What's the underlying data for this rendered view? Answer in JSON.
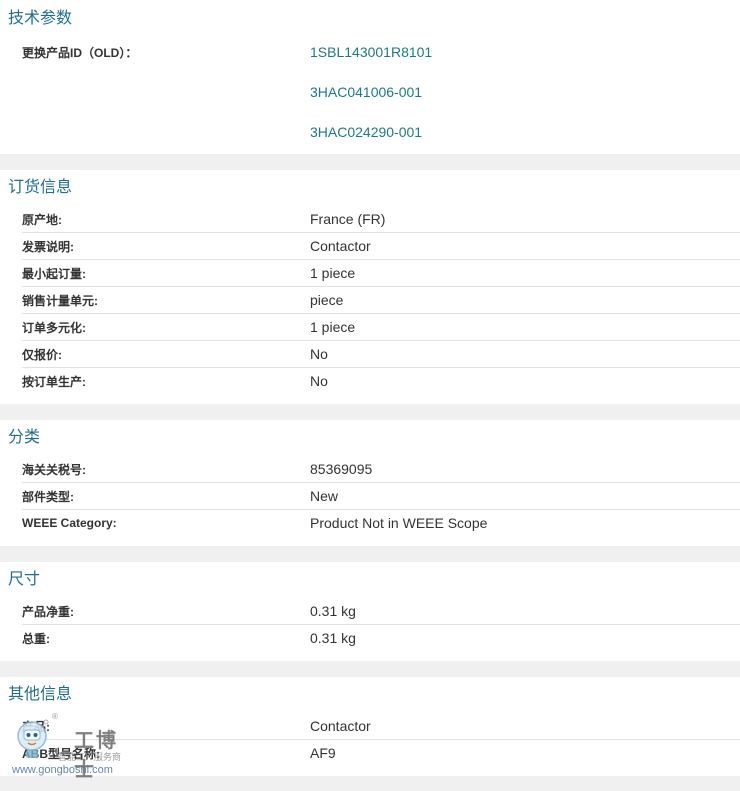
{
  "sections": {
    "tech": {
      "title": "技术参数",
      "replace_label": "更换产品ID（OLD）：",
      "replace_ids": [
        "1SBL143001R8101",
        "3HAC041006-001",
        "3HAC024290-001"
      ]
    },
    "order": {
      "title": "订货信息",
      "rows": [
        {
          "label": "原产地:",
          "value": "France (FR)"
        },
        {
          "label": "发票说明:",
          "value": "Contactor"
        },
        {
          "label": "最小起订量:",
          "value": "1 piece"
        },
        {
          "label": "销售计量单元:",
          "value": "piece"
        },
        {
          "label": "订单多元化:",
          "value": "1 piece"
        },
        {
          "label": "仅报价:",
          "value": "No"
        },
        {
          "label": "按订单生产:",
          "value": "No"
        }
      ]
    },
    "classification": {
      "title": "分类",
      "rows": [
        {
          "label": "海关关税号:",
          "value": "85369095"
        },
        {
          "label": "部件类型:",
          "value": "New"
        },
        {
          "label": "WEEE Category:",
          "value": "Product Not in WEEE Scope"
        }
      ]
    },
    "dimensions": {
      "title": "尺寸",
      "rows": [
        {
          "label": "产品净重:",
          "value": "0.31 kg"
        },
        {
          "label": "总重:",
          "value": "0.31 kg"
        }
      ]
    },
    "other": {
      "title": "其他信息",
      "rows": [
        {
          "label": "产品:",
          "value": "Contactor"
        },
        {
          "label": "ABB型号名称:",
          "value": "AF9"
        }
      ]
    }
  },
  "watermark": {
    "brand": "工博士",
    "tagline": "智能工厂服务商",
    "url": "www.gongboshi.com",
    "registered": "®"
  },
  "colors": {
    "title": "#1f6f8b",
    "link": "#1a7a8c",
    "gap": "#f0f0f0",
    "divider": "#e2e2e2"
  }
}
